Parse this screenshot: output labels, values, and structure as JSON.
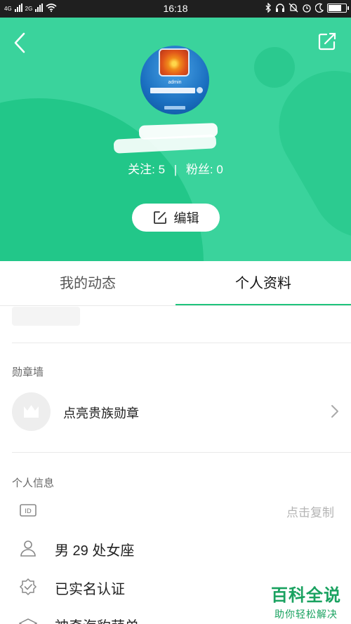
{
  "status_bar": {
    "sim1": "4G",
    "sim2": "2G",
    "time": "16:18",
    "battery_level": 0.7
  },
  "header": {
    "colors": {
      "background": "#3ad39c",
      "accent": "#1fc47d"
    },
    "follow": {
      "following_label": "关注:",
      "following_count": "5",
      "separator": "|",
      "fans_label": "粉丝:",
      "fans_count": "0"
    },
    "avatar": {
      "username_text": "admin"
    },
    "edit_button_label": "编辑"
  },
  "tabs": [
    {
      "label": "我的动态",
      "active": false
    },
    {
      "label": "个人资料",
      "active": true
    }
  ],
  "badges": {
    "section_title": "勋章墙",
    "item_label": "点亮贵族勋章"
  },
  "personal_info": {
    "section_title": "个人信息",
    "id_icon_text": "ID",
    "copy_label": "点击复制",
    "gender_age_zodiac": "男 29 处女座",
    "verified_label": "已实名认证",
    "partial_row_text": "神奇海豹萌单"
  },
  "watermark": {
    "title": "百科全说",
    "subtitle": "助你轻松解决"
  },
  "icons": [
    "back-icon",
    "share-edit-icon",
    "edit-pencil-icon",
    "crown-icon",
    "chevron-right-icon",
    "id-card-icon",
    "person-icon",
    "verified-badge-icon",
    "graduation-icon"
  ]
}
